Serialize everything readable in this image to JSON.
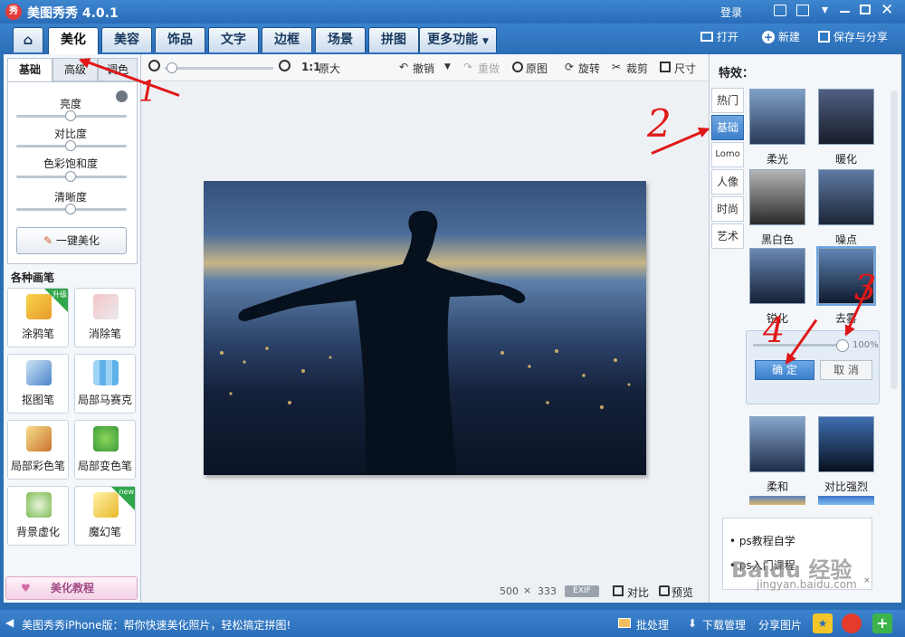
{
  "app": {
    "title": "美图秀秀 4.0.1",
    "login": "登录",
    "logo_char": "秀"
  },
  "main_tabs": [
    "美化",
    "美容",
    "饰品",
    "文字",
    "边框",
    "场景",
    "拼图",
    "更多功能"
  ],
  "top_actions": {
    "open": "打开",
    "new": "新建",
    "save": "保存与分享"
  },
  "left": {
    "sub_tabs": [
      "基础",
      "高级",
      "调色"
    ],
    "sliders": [
      "亮度",
      "对比度",
      "色彩饱和度",
      "清晰度"
    ],
    "one_click": "一键美化",
    "brushes_title": "各种画笔",
    "tools": [
      {
        "label": "涂鸦笔",
        "badge": "升级"
      },
      {
        "label": "消除笔",
        "badge": ""
      },
      {
        "label": "抠图笔",
        "badge": ""
      },
      {
        "label": "局部马赛克",
        "badge": ""
      },
      {
        "label": "局部彩色笔",
        "badge": ""
      },
      {
        "label": "局部变色笔",
        "badge": ""
      },
      {
        "label": "背景虚化",
        "badge": ""
      },
      {
        "label": "魔幻笔",
        "badge": "new"
      }
    ],
    "tutorial": "美化教程"
  },
  "toolbar": {
    "ratio": "1:1",
    "original_size": "原大",
    "undo": "撤销",
    "redo": "重做",
    "original": "原图",
    "rotate": "旋转",
    "crop": "裁剪",
    "size": "尺寸"
  },
  "image_info": {
    "width": "500",
    "x": "×",
    "height": "333",
    "exif": "EXIF",
    "compare": "对比",
    "preview": "预览"
  },
  "right": {
    "title": "特效：",
    "categories": [
      "热门",
      "基础",
      "Lomo",
      "人像",
      "时尚",
      "艺术"
    ],
    "effects": [
      "柔光",
      "暖化",
      "黑白色",
      "噪点",
      "锐化",
      "去雾",
      "柔和",
      "对比强烈"
    ],
    "intensity": "100%",
    "intensity_value": 100,
    "confirm": "确 定",
    "cancel": "取 消",
    "links": [
      "ps教程自学",
      "ps入门课程"
    ],
    "ad_close": "×"
  },
  "annotations": [
    "1",
    "2",
    "3",
    "4"
  ],
  "status": {
    "message": "美图秀秀iPhone版：帮你快速美化照片，轻松搞定拼图!",
    "batch": "批处理",
    "download": "下载管理",
    "share": "分享图片"
  },
  "watermark": {
    "text": "Baidu 经验",
    "url": "jingyan.baidu.com"
  },
  "colors": {
    "accent": "#2a6cb8",
    "annotation": "#e01818"
  }
}
